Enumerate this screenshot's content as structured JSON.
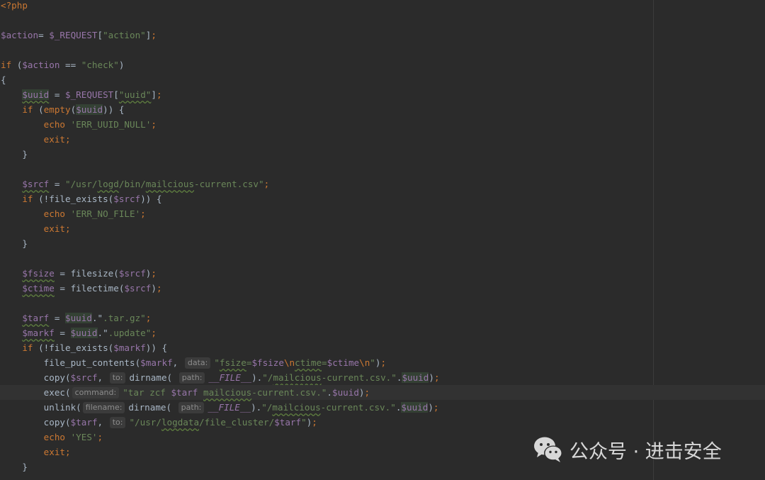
{
  "editor": {
    "lines": [
      [
        [
          "tag",
          "<?php"
        ]
      ],
      [],
      [
        [
          "var",
          "$action"
        ],
        [
          "",
          "= "
        ],
        [
          "var",
          "$_REQUEST"
        ],
        [
          "",
          "["
        ],
        [
          "str",
          "\"action\""
        ],
        [
          "",
          "]"
        ],
        [
          "kw",
          ";"
        ]
      ],
      [],
      [
        [
          "kw",
          "if "
        ],
        [
          "",
          "("
        ],
        [
          "var",
          "$action"
        ],
        [
          "",
          " == "
        ],
        [
          "str",
          "\"check\""
        ],
        [
          "",
          ")"
        ]
      ],
      [
        [
          "",
          "{"
        ]
      ],
      [
        [
          "",
          "    "
        ],
        [
          "var hl warn",
          "$uuid"
        ],
        [
          "",
          " = "
        ],
        [
          "var",
          "$_REQUEST"
        ],
        [
          "",
          "["
        ],
        [
          "str warn",
          "\"uuid\""
        ],
        [
          "",
          "]"
        ],
        [
          "kw",
          ";"
        ]
      ],
      [
        [
          "",
          "    "
        ],
        [
          "kw",
          "if "
        ],
        [
          "",
          "("
        ],
        [
          "kw",
          "empty"
        ],
        [
          "",
          "("
        ],
        [
          "var hl",
          "$uuid"
        ],
        [
          "",
          ")) {"
        ]
      ],
      [
        [
          "",
          "        "
        ],
        [
          "kw",
          "echo "
        ],
        [
          "str",
          "'ERR_UUID_NULL'"
        ],
        [
          "kw",
          ";"
        ]
      ],
      [
        [
          "",
          "        "
        ],
        [
          "kw",
          "exit"
        ],
        [
          "kw",
          ";"
        ]
      ],
      [
        [
          "",
          "    }"
        ]
      ],
      [],
      [
        [
          "",
          "    "
        ],
        [
          "var warn",
          "$srcf"
        ],
        [
          "",
          " = "
        ],
        [
          "str",
          "\"/usr/"
        ],
        [
          "str warn",
          "logd"
        ],
        [
          "str",
          "/bin/"
        ],
        [
          "str warn",
          "mailcious"
        ],
        [
          "str",
          "-current.csv\""
        ],
        [
          "kw",
          ";"
        ]
      ],
      [
        [
          "",
          "    "
        ],
        [
          "kw",
          "if "
        ],
        [
          "",
          "(!"
        ],
        [
          "fn",
          "file_exists"
        ],
        [
          "",
          "("
        ],
        [
          "var",
          "$srcf"
        ],
        [
          "",
          ")) {"
        ]
      ],
      [
        [
          "",
          "        "
        ],
        [
          "kw",
          "echo "
        ],
        [
          "str",
          "'ERR_NO_FILE'"
        ],
        [
          "kw",
          ";"
        ]
      ],
      [
        [
          "",
          "        "
        ],
        [
          "kw",
          "exit"
        ],
        [
          "kw",
          ";"
        ]
      ],
      [
        [
          "",
          "    }"
        ]
      ],
      [],
      [
        [
          "",
          "    "
        ],
        [
          "var warn",
          "$fsize"
        ],
        [
          "",
          " = "
        ],
        [
          "fn",
          "filesize"
        ],
        [
          "",
          "("
        ],
        [
          "var",
          "$srcf"
        ],
        [
          "",
          ")"
        ],
        [
          "kw",
          ";"
        ]
      ],
      [
        [
          "",
          "    "
        ],
        [
          "var warn",
          "$ctime"
        ],
        [
          "",
          " = "
        ],
        [
          "fn",
          "filectime"
        ],
        [
          "",
          "("
        ],
        [
          "var",
          "$srcf"
        ],
        [
          "",
          ")"
        ],
        [
          "kw",
          ";"
        ]
      ],
      [],
      [
        [
          "",
          "    "
        ],
        [
          "var warn",
          "$tarf"
        ],
        [
          "",
          " = "
        ],
        [
          "var hl",
          "$uuid"
        ],
        [
          "",
          ".\""
        ],
        [
          "str",
          ".tar.gz\""
        ],
        [
          "kw",
          ";"
        ]
      ],
      [
        [
          "",
          "    "
        ],
        [
          "var warn",
          "$markf"
        ],
        [
          "",
          " = "
        ],
        [
          "var hl",
          "$uuid"
        ],
        [
          "",
          ".\""
        ],
        [
          "str",
          ".update\""
        ],
        [
          "kw",
          ";"
        ]
      ],
      [
        [
          "",
          "    "
        ],
        [
          "kw",
          "if "
        ],
        [
          "",
          "(!"
        ],
        [
          "fn",
          "file_exists"
        ],
        [
          "",
          "("
        ],
        [
          "var",
          "$markf"
        ],
        [
          "",
          ")) {"
        ]
      ],
      [
        [
          "",
          "        "
        ],
        [
          "fn",
          "file_put_contents"
        ],
        [
          "",
          "("
        ],
        [
          "var",
          "$markf"
        ],
        [
          "",
          ", "
        ],
        [
          "hint",
          "data:"
        ],
        [
          "str",
          "\""
        ],
        [
          "str warn",
          "fsize"
        ],
        [
          "str",
          "="
        ],
        [
          "var",
          "$fsize"
        ],
        [
          "esc",
          "\\n"
        ],
        [
          "str warn",
          "ctime"
        ],
        [
          "str",
          "="
        ],
        [
          "var",
          "$ctime"
        ],
        [
          "esc",
          "\\n"
        ],
        [
          "str",
          "\""
        ],
        [
          "",
          ")"
        ],
        [
          "kw",
          ";"
        ]
      ],
      [
        [
          "",
          "        "
        ],
        [
          "fn",
          "copy"
        ],
        [
          "",
          "("
        ],
        [
          "var",
          "$srcf"
        ],
        [
          "",
          ", "
        ],
        [
          "hint",
          "to:"
        ],
        [
          "fn",
          "dirname"
        ],
        [
          "",
          "( "
        ],
        [
          "hint",
          "path:"
        ],
        [
          "const",
          "__FILE__"
        ],
        [
          "",
          ")."
        ],
        [
          "str",
          "\"/"
        ],
        [
          "str warn",
          "mailcious"
        ],
        [
          "str",
          "-current.csv.\""
        ],
        [
          "",
          "."
        ],
        [
          "var hl",
          "$uuid"
        ],
        [
          "",
          ")"
        ],
        [
          "kw",
          ";"
        ]
      ],
      [
        [
          "",
          "        "
        ],
        [
          "fn",
          "exec"
        ],
        [
          "",
          "("
        ],
        [
          "hint",
          "command:"
        ],
        [
          "str",
          "\"tar zcf "
        ],
        [
          "var",
          "$tarf"
        ],
        [
          "str",
          " "
        ],
        [
          "str warn",
          "mailcious"
        ],
        [
          "str",
          "-current.csv.\""
        ],
        [
          "",
          "."
        ],
        [
          "var",
          "$uuid"
        ],
        [
          "",
          ")"
        ],
        [
          "kw",
          ";"
        ]
      ],
      [
        [
          "",
          "        "
        ],
        [
          "fn",
          "unlink"
        ],
        [
          "",
          "("
        ],
        [
          "hint",
          "filename:"
        ],
        [
          "fn",
          "dirname"
        ],
        [
          "",
          "( "
        ],
        [
          "hint",
          "path:"
        ],
        [
          "const",
          "__FILE__"
        ],
        [
          "",
          ")."
        ],
        [
          "str",
          "\"/"
        ],
        [
          "str warn",
          "mailcious"
        ],
        [
          "str",
          "-current.csv.\""
        ],
        [
          "",
          "."
        ],
        [
          "var hl",
          "$uuid"
        ],
        [
          "",
          ")"
        ],
        [
          "kw",
          ";"
        ]
      ],
      [
        [
          "",
          "        "
        ],
        [
          "fn",
          "copy"
        ],
        [
          "",
          "("
        ],
        [
          "var",
          "$tarf"
        ],
        [
          "",
          ", "
        ],
        [
          "hint",
          "to:"
        ],
        [
          "str",
          "\"/usr/"
        ],
        [
          "str warn",
          "logdata"
        ],
        [
          "str",
          "/file_cluster/"
        ],
        [
          "var",
          "$tarf"
        ],
        [
          "str",
          "\""
        ],
        [
          "",
          ")"
        ],
        [
          "kw",
          ";"
        ]
      ],
      [
        [
          "",
          "        "
        ],
        [
          "kw",
          "echo "
        ],
        [
          "str",
          "'YES'"
        ],
        [
          "kw",
          ";"
        ]
      ],
      [
        [
          "",
          "        "
        ],
        [
          "kw",
          "exit"
        ],
        [
          "kw",
          ";"
        ]
      ],
      [
        [
          "",
          "    }"
        ]
      ]
    ],
    "current_line": 26
  },
  "watermark": {
    "text": "公众号 · 进击安全",
    "icon": "wechat-icon"
  }
}
